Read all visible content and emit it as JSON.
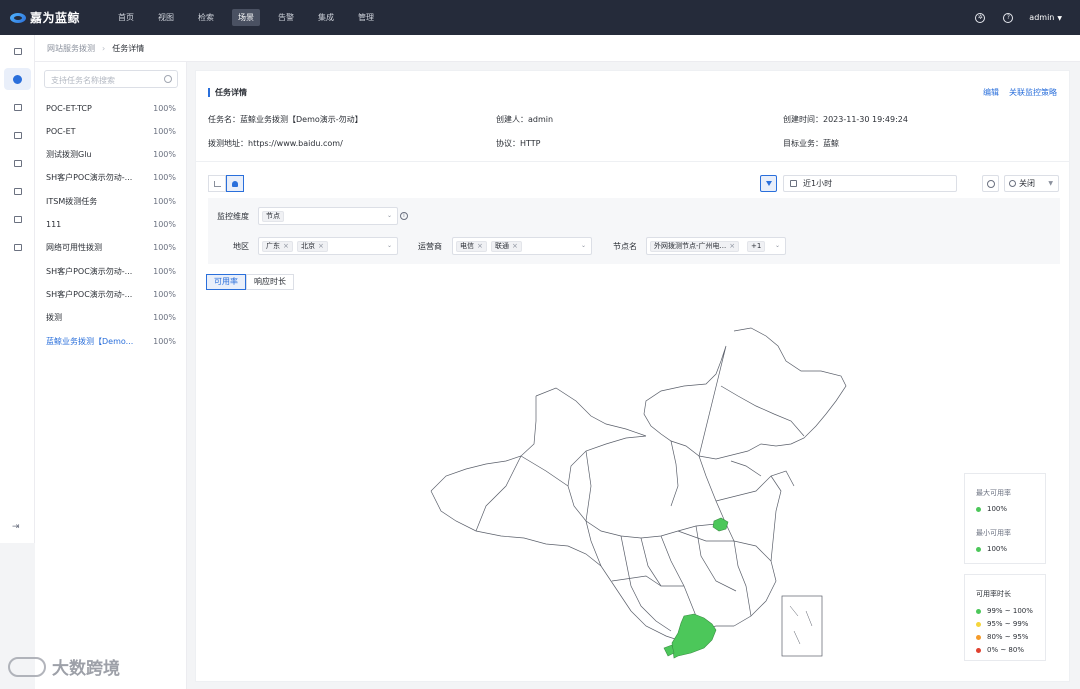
{
  "header": {
    "logo_text": "嘉为蓝鲸",
    "nav": [
      "首页",
      "视图",
      "检索",
      "场景",
      "告警",
      "集成",
      "管理"
    ],
    "active_nav_index": 3,
    "user": "admin"
  },
  "breadcrumb": {
    "parent": "网站服务拨测",
    "current": "任务详情"
  },
  "tasklist": {
    "search_placeholder": "支持任务名称搜索",
    "items": [
      {
        "name": "POC-ET-TCP",
        "pct": "100%"
      },
      {
        "name": "POC-ET",
        "pct": "100%"
      },
      {
        "name": "测试拨测Glu",
        "pct": "100%"
      },
      {
        "name": "SH客户POC演示勿动-...",
        "pct": "100%"
      },
      {
        "name": "ITSM拨测任务",
        "pct": "100%"
      },
      {
        "name": "111",
        "pct": "100%"
      },
      {
        "name": "网络可用性拨测",
        "pct": "100%"
      },
      {
        "name": "SH客户POC演示勿动-...",
        "pct": "100%"
      },
      {
        "name": "SH客户POC演示勿动-...",
        "pct": "100%"
      },
      {
        "name": "拨测",
        "pct": "100%"
      },
      {
        "name": "蓝鲸业务拨测【Demo...",
        "pct": "100%"
      }
    ],
    "active_index": 10
  },
  "detail": {
    "title": "任务详情",
    "edit": "编辑",
    "link_policy": "关联监控策略",
    "task_name": "任务名：蓝鲸业务拨测【Demo演示-勿动】",
    "creator": "创建人：admin",
    "created_time": "创建时间：2023-11-30 19:49:24",
    "url": "拨测地址：https://www.baidu.com/",
    "protocol": "协议：HTTP",
    "biz": "目标业务：蓝鲸"
  },
  "toolbar": {
    "time_range": "近1小时",
    "auto_refresh": "关闭"
  },
  "filters": {
    "dim_label": "监控维度",
    "dim_value": "节点",
    "region_label": "地区",
    "region_tags": [
      "广东",
      "北京"
    ],
    "isp_label": "运营商",
    "isp_tags": [
      "电信",
      "联通"
    ],
    "node_label": "节点名",
    "node_tags": [
      "外网拨测节点-广州电..."
    ],
    "node_more": "+1"
  },
  "tabs": [
    "可用率",
    "响应时长"
  ],
  "active_tab_index": 0,
  "map": {
    "highlight_color": "#4cc75a",
    "highlighted_regions": [
      "北京",
      "广东"
    ]
  },
  "legend_max": {
    "title": "最大可用率",
    "value": "100%",
    "color": "#4cc75a"
  },
  "legend_min": {
    "title": "最小可用率",
    "value": "100%",
    "color": "#4cc75a"
  },
  "legend_ranges": {
    "title": "可用率时长",
    "items": [
      {
        "label": "99% ~ 100%",
        "color": "#4cc75a"
      },
      {
        "label": "95% ~ 99%",
        "color": "#f5d53b"
      },
      {
        "label": "80% ~ 95%",
        "color": "#f59b2a"
      },
      {
        "label": "0% ~ 80%",
        "color": "#e0412f"
      }
    ]
  },
  "watermark": "大数跨境"
}
